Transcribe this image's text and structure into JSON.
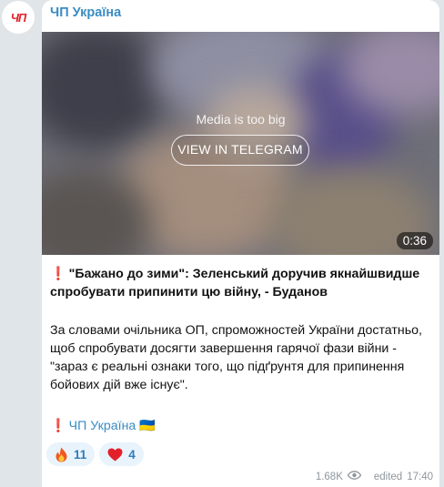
{
  "channel": {
    "avatar_text": "ЧП",
    "name": "ЧП Україна"
  },
  "media": {
    "notice": "Media is too big",
    "button_label": "VIEW IN TELEGRAM",
    "duration": "0:36"
  },
  "post": {
    "headline": "\"Бажано до зими\": Зеленський доручив якнайшвидше спробувати припинити цю війну, - Буданов",
    "body": "За словами очільника ОП, спроможностей України достатньо, щоб спробувати досягти завершення гарячої фази війни - \"зараз є реальні ознаки того, що підґрунтя для припинення бойових дій вже існує\".",
    "footer_link": "ЧП Україна",
    "footer_flag": "🇺🇦"
  },
  "reactions": [
    {
      "icon": "fire-icon",
      "count": "11"
    },
    {
      "icon": "heart-icon",
      "count": "4"
    }
  ],
  "meta": {
    "views": "1.68K",
    "edited_label": "edited",
    "time": "17:40"
  },
  "colors": {
    "accent": "#3a8cc4",
    "background": "#dfe5e8",
    "reaction_bg": "#e9f3fb",
    "logo_red": "#e0252b"
  }
}
